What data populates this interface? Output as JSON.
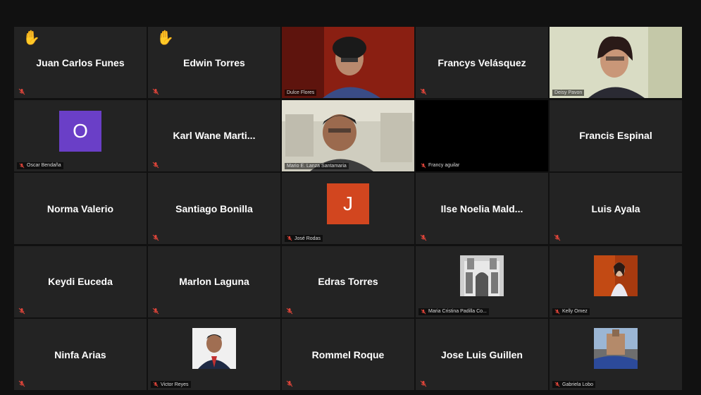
{
  "participants": [
    {
      "name": "Juan Carlos Funes",
      "hand_raised": true
    },
    {
      "name": "Edwin Torres",
      "hand_raised": true
    },
    {
      "label": "Dulce Flores"
    },
    {
      "name": "Francys Velásquez"
    },
    {
      "label": "Deisy Pavon"
    },
    {
      "label": "Oscar Bendaña",
      "initial": "O",
      "avatar_color": "#6a3fc7"
    },
    {
      "name": "Karl Wane Marti..."
    },
    {
      "label": "Mario E. Lanza Santamaria"
    },
    {
      "label": "Francy aguilar"
    },
    {
      "name": "Francis Espinal"
    },
    {
      "name": "Norma Valerio"
    },
    {
      "name": "Santiago Bonilla"
    },
    {
      "label": "José Rodas",
      "initial": "J",
      "avatar_color": "#d2461f"
    },
    {
      "name": "Ilse Noelia Mald..."
    },
    {
      "name": "Luis Ayala"
    },
    {
      "name": "Keydi Euceda"
    },
    {
      "name": "Marlon Laguna"
    },
    {
      "name": "Edras Torres"
    },
    {
      "label": "Maria Cristina Padilla Co..."
    },
    {
      "label": "Kelly Omez"
    },
    {
      "name": "Ninfa Arias"
    },
    {
      "label": "Victor Reyes"
    },
    {
      "name": "Rommel Roque"
    },
    {
      "name": "Jose Luis Guillen"
    },
    {
      "label": "Gabriela Lobo"
    }
  ],
  "icons": {
    "hand": "raised-hand-icon",
    "mic": "muted-mic-icon"
  },
  "colors": {
    "tile_bg": "#232323",
    "active_speaker": "#b9d53c",
    "muted": "#e0453a"
  }
}
